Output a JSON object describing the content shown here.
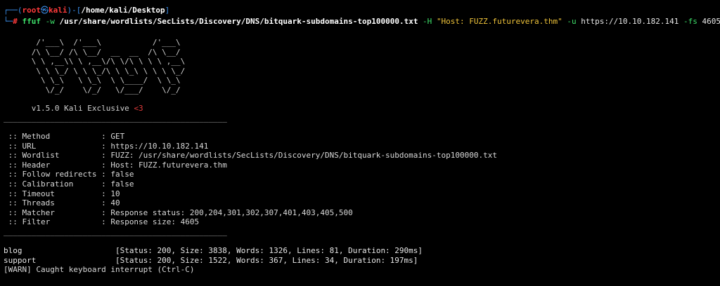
{
  "prompt": {
    "frame_top": "┌──(",
    "user": "root",
    "skull": "㉿",
    "host": "kali",
    "frame_close": ")-[",
    "path": "/home/kali/Desktop",
    "frame_end": "]",
    "frame_bottom": "└─",
    "hash": "# "
  },
  "command": {
    "tool": "ffuf",
    "flag_w": " -w ",
    "wordlist": "/usr/share/wordlists/SecLists/Discovery/DNS/bitquark-subdomains-top100000.txt",
    "flag_h": " -H ",
    "header": "\"Host: FUZZ.futurevera.thm\"",
    "flag_u": " -u ",
    "url": "https://10.10.182.141",
    "flag_fs": " -fs ",
    "size": "4605"
  },
  "banner": {
    "art": [
      "       /'___\\  /'___\\           /'___\\",
      "      /\\ \\__/ /\\ \\__/  __  __  /\\ \\__/",
      "      \\ \\ ,__\\\\ \\ ,__\\/\\ \\/\\ \\ \\ \\ ,__\\",
      "       \\ \\ \\_/ \\ \\ \\_/\\ \\ \\_\\ \\ \\ \\ \\_/",
      "        \\ \\_\\   \\ \\_\\  \\ \\____/  \\ \\_\\",
      "         \\/_/    \\/_/   \\/___/    \\/_/"
    ],
    "version": "      v1.5.0 Kali Exclusive ",
    "heart": "<3"
  },
  "separator": "________________________________________________",
  "config": [
    {
      "key": " :: Method           ",
      "value": ": GET"
    },
    {
      "key": " :: URL              ",
      "value": ": https://10.10.182.141"
    },
    {
      "key": " :: Wordlist         ",
      "value": ": FUZZ: /usr/share/wordlists/SecLists/Discovery/DNS/bitquark-subdomains-top100000.txt"
    },
    {
      "key": " :: Header           ",
      "value": ": Host: FUZZ.futurevera.thm"
    },
    {
      "key": " :: Follow redirects ",
      "value": ": false"
    },
    {
      "key": " :: Calibration      ",
      "value": ": false"
    },
    {
      "key": " :: Timeout          ",
      "value": ": 10"
    },
    {
      "key": " :: Threads          ",
      "value": ": 40"
    },
    {
      "key": " :: Matcher          ",
      "value": ": Response status: 200,204,301,302,307,401,403,405,500"
    },
    {
      "key": " :: Filter           ",
      "value": ": Response size: 4605"
    }
  ],
  "results": [
    {
      "name": "blog                    ",
      "detail": "[Status: 200, Size: 3838, Words: 1326, Lines: 81, Duration: 290ms]"
    },
    {
      "name": "support                 ",
      "detail": "[Status: 200, Size: 1522, Words: 367, Lines: 34, Duration: 197ms]"
    }
  ],
  "warning": "[WARN] Caught keyboard interrupt (Ctrl-C)"
}
